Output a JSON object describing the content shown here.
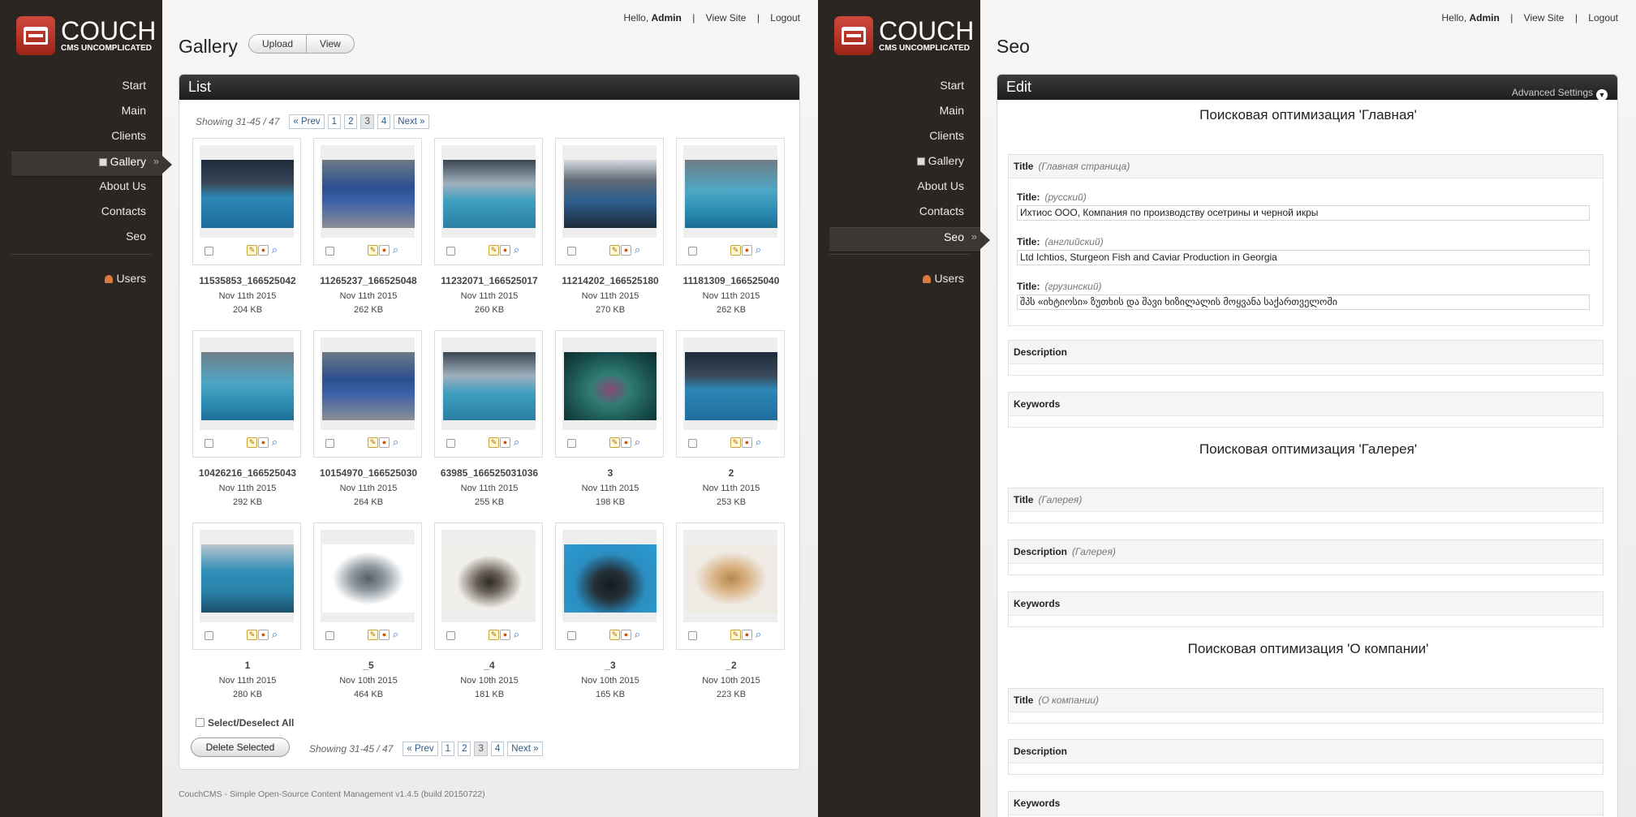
{
  "brand": {
    "name": "COUCH",
    "tagline": "CMS UNCOMPLICATED"
  },
  "top": {
    "hello": "Hello,",
    "user": "Admin",
    "view_site": "View Site",
    "logout": "Logout",
    "sep": "|"
  },
  "nav_left": [
    {
      "label": "Start"
    },
    {
      "label": "Main"
    },
    {
      "label": "Clients"
    },
    {
      "label": "Gallery",
      "active": true
    },
    {
      "label": "About Us"
    },
    {
      "label": "Contacts"
    },
    {
      "label": "Seo"
    }
  ],
  "nav_users": "Users",
  "nav_arrow": "»",
  "gallery": {
    "title": "Gallery",
    "buttons": [
      "Upload",
      "View"
    ],
    "panel_title": "List",
    "showing": "Showing 31-45 / 47",
    "prev": "« Prev",
    "next": "Next »",
    "pages": [
      "1",
      "2",
      "3",
      "4"
    ],
    "current_page": "3",
    "items": [
      {
        "name": "11535853_166525042",
        "date": "Nov 11th 2015",
        "size": "204 KB",
        "thumb": "pool-dark"
      },
      {
        "name": "11265237_166525048",
        "date": "Nov 11th 2015",
        "size": "262 KB",
        "thumb": "hall-blue"
      },
      {
        "name": "11232071_166525017",
        "date": "Nov 11th 2015",
        "size": "260 KB",
        "thumb": "pool-light"
      },
      {
        "name": "11214202_166525180",
        "date": "Nov 11th 2015",
        "size": "270 KB",
        "thumb": "hall-banner"
      },
      {
        "name": "11181309_166525040",
        "date": "Nov 11th 2015",
        "size": "262 KB",
        "thumb": "pool-teal"
      },
      {
        "name": "10426216_166525043",
        "date": "Nov 11th 2015",
        "size": "292 KB",
        "thumb": "pool-teal"
      },
      {
        "name": "10154970_166525030",
        "date": "Nov 11th 2015",
        "size": "264 KB",
        "thumb": "hall-blue"
      },
      {
        "name": "63985_166525031036",
        "date": "Nov 11th 2015",
        "size": "255 KB",
        "thumb": "pool-light"
      },
      {
        "name": "3",
        "date": "Nov 11th 2015",
        "size": "198 KB",
        "thumb": "fish-water"
      },
      {
        "name": "2",
        "date": "Nov 11th 2015",
        "size": "253 KB",
        "thumb": "pool-dark"
      },
      {
        "name": "1",
        "date": "Nov 11th 2015",
        "size": "280 KB",
        "thumb": "fish-pool"
      },
      {
        "name": "_5",
        "date": "Nov 10th 2015",
        "size": "464 KB",
        "thumb": "fish-white"
      },
      {
        "name": "_4",
        "date": "Nov 10th 2015",
        "size": "181 KB",
        "thumb": "fish-white2"
      },
      {
        "name": "_3",
        "date": "Nov 10th 2015",
        "size": "165 KB",
        "thumb": "fish-blue"
      },
      {
        "name": "_2",
        "date": "Nov 10th 2015",
        "size": "223 KB",
        "thumb": "fish-gold"
      }
    ],
    "select_all": "Select/Deselect All",
    "delete_selected": "Delete Selected",
    "footer": "CouchCMS - Simple Open-Source Content Management v1.4.5 (build 20150722)"
  },
  "nav_right": [
    {
      "label": "Start"
    },
    {
      "label": "Main"
    },
    {
      "label": "Clients"
    },
    {
      "label": "Gallery"
    },
    {
      "label": "About Us"
    },
    {
      "label": "Contacts"
    },
    {
      "label": "Seo",
      "active": true
    }
  ],
  "seo": {
    "title": "Seo",
    "panel_title": "Edit",
    "advanced": "Advanced Settings",
    "h1": "Поисковая оптимизация 'Главная'",
    "s1_title": "Title",
    "s1_title_hint": "(Главная страница)",
    "field_label": "Title:",
    "f_ru_hint": "(русский)",
    "f_ru_val": "Ихтиос ООО, Компания по производству осетрины и черной икры",
    "f_en_hint": "(английский)",
    "f_en_val": "Ltd Ichtios, Sturgeon Fish and Caviar Production in Georgia",
    "f_ka_hint": "(грузинский)",
    "f_ka_val": "შპს «იხტიოსი» ზუთხის და შავი ხიზილალის მოყვანა საქართველოში",
    "description": "Description",
    "keywords": "Keywords",
    "h2": "Поисковая оптимизация 'Галерея'",
    "s2_title_hint": "(Галерея)",
    "s2_desc_hint": "(Галерея)",
    "h3": "Поисковая оптимизация 'О компании'",
    "s3_title_hint": "(О компании)"
  }
}
